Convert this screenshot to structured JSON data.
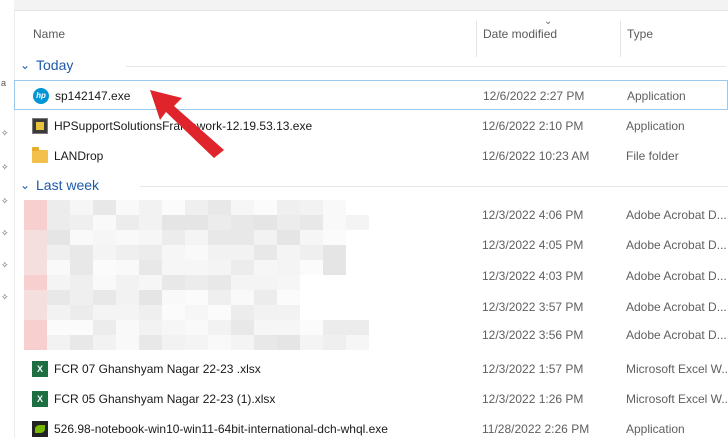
{
  "columns": {
    "name": "Name",
    "date": "Date modified",
    "type": "Type"
  },
  "nav_glyphs": [
    "a",
    "✧",
    "✧",
    "✧",
    "✧",
    "✧",
    "✧"
  ],
  "groups": [
    {
      "label": "Today"
    },
    {
      "label": "Last week"
    }
  ],
  "rows": [
    {
      "name": "sp142147.exe",
      "date": "12/6/2022 2:27 PM",
      "type": "Application",
      "icon": "hp-logo-icon",
      "selected": true
    },
    {
      "name": "HPSupportSolutionsFramework-12.19.53.13.exe",
      "date": "12/6/2022 2:10 PM",
      "type": "Application",
      "icon": "setup-exe-icon"
    },
    {
      "name": "LANDrop",
      "date": "12/6/2022 10:23 AM",
      "type": "File folder",
      "icon": "folder-icon"
    },
    {
      "name": "",
      "date": "12/3/2022 4:06 PM",
      "type": "Adobe Acrobat D...",
      "icon": ""
    },
    {
      "name": "",
      "date": "12/3/2022 4:05 PM",
      "type": "Adobe Acrobat D...",
      "icon": ""
    },
    {
      "name": "",
      "date": "12/3/2022 4:03 PM",
      "type": "Adobe Acrobat D...",
      "icon": ""
    },
    {
      "name": "",
      "date": "12/3/2022 3:57 PM",
      "type": "Adobe Acrobat D...",
      "icon": ""
    },
    {
      "name": "",
      "date": "12/3/2022 3:56 PM",
      "type": "Adobe Acrobat D...",
      "icon": ""
    },
    {
      "name": "FCR 07 Ghanshyam Nagar 22-23 .xlsx",
      "date": "12/3/2022 1:57 PM",
      "type": "Microsoft Excel W...",
      "icon": "excel-icon"
    },
    {
      "name": "FCR 05 Ghanshyam Nagar 22-23 (1).xlsx",
      "date": "12/3/2022 1:26 PM",
      "type": "Microsoft Excel W...",
      "icon": "excel-icon"
    },
    {
      "name": "526.98-notebook-win10-win11-64bit-international-dch-whql.exe",
      "date": "11/28/2022 2:26 PM",
      "type": "Application",
      "icon": "nvidia-icon"
    }
  ],
  "icon_glyphs": {
    "hp": "hp",
    "excel": "X"
  },
  "colors": {
    "group_label": "#1e5aa8",
    "selection_border": "#99c9ef",
    "annotation_arrow": "#e0242b"
  }
}
